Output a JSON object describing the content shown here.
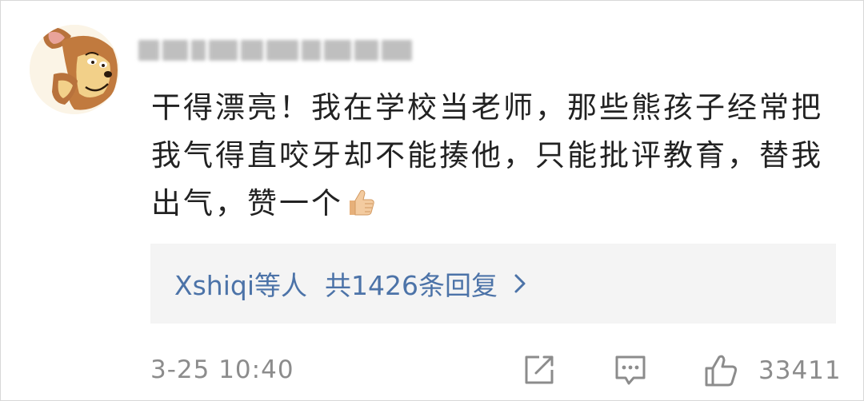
{
  "comment": {
    "text": "干得漂亮！我在学校当老师，那些熊孩子经常把我气得直咬牙却不能揍他，只能批评教育，替我出气，赞一个",
    "emoji": "thumbs-up"
  },
  "replies": {
    "users": "Xshiqi等人",
    "summary": "共1426条回复"
  },
  "footer": {
    "timestamp": "3-25 10:40",
    "like_count": "33411"
  },
  "icons": {
    "share": "share-icon",
    "comment": "comment-icon",
    "like": "thumbs-up-icon",
    "chevron": "chevron-right-icon"
  },
  "colors": {
    "link": "#4c73a8",
    "meta": "#8c8c8c",
    "text": "#222222",
    "reply_bg": "#f4f4f4"
  }
}
